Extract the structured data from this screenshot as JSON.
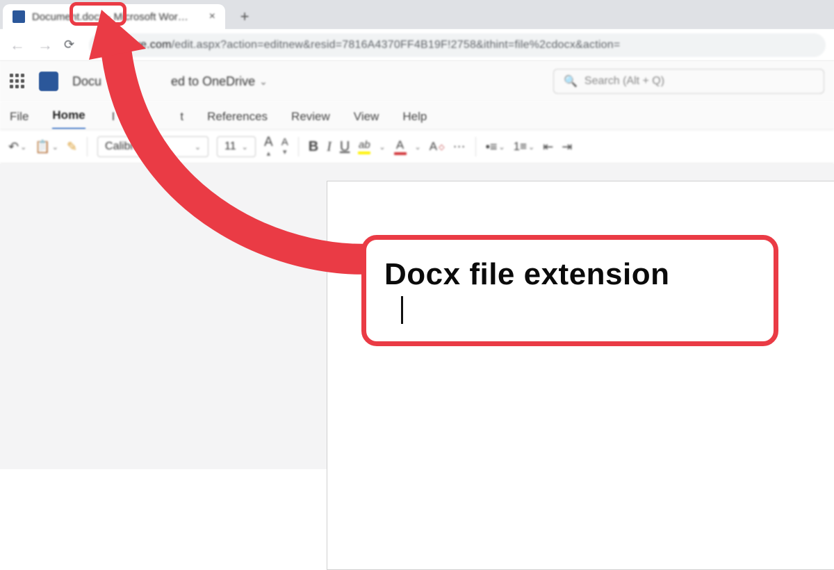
{
  "browser": {
    "tab_title": "Document.docx - Microsoft Wor…",
    "close_glyph": "×",
    "new_tab_glyph": "+",
    "back_glyph": "←",
    "forward_glyph": "→",
    "reload_glyph": "⟳",
    "url_host": "drive.live.com",
    "url_rest": "/edit.aspx?action=editnew&resid=7816A4370FF4B19F!2758&ithint=file%2cdocx&action="
  },
  "header": {
    "doc_name_left": "Docu",
    "doc_name_right": "ed to OneDrive",
    "chevron": "⌄",
    "search_placeholder": "Search (Alt + Q)",
    "search_icon": "🔍"
  },
  "ribbon": {
    "tabs": [
      "File",
      "Home",
      "I",
      "t",
      "References",
      "Review",
      "View",
      "Help"
    ],
    "active_tab_index": 1
  },
  "toolbar": {
    "undo": "↶",
    "paste": "📋",
    "format_painter": "�brush",
    "font_name": "Calibri (",
    "font_size": "11",
    "grow": "A",
    "shrink": "A",
    "bold": "B",
    "italic": "I",
    "underline": "U",
    "highlight_letter": "ab",
    "font_color_letter": "A",
    "clear_fmt": "A",
    "more": "⋯",
    "bullets": "≣",
    "numbering": "≣",
    "indent_dec": "⇤",
    "indent_inc": "⇥",
    "chev": "⌄",
    "sup": "▴",
    "sub": "▾"
  },
  "annotation": {
    "callout_text": "Docx file extension"
  }
}
